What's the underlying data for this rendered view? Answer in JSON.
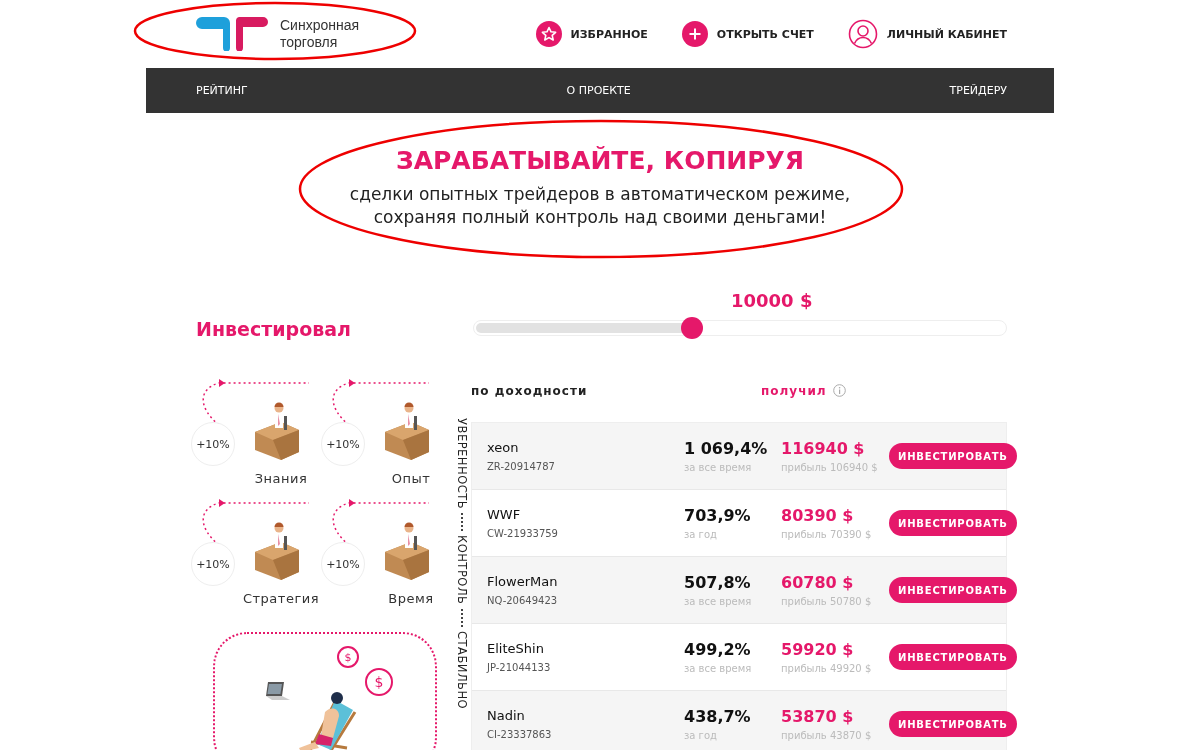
{
  "logo": {
    "lines": [
      "Синхронная",
      "торговля"
    ]
  },
  "header_links": [
    {
      "kind": "star",
      "label": "ИЗБРАННОЕ"
    },
    {
      "kind": "plus",
      "label": "ОТКРЫТЬ СЧЕТ"
    },
    {
      "kind": "user",
      "label": "ЛИЧНЫЙ КАБИНЕТ"
    }
  ],
  "nav": [
    "РЕЙТИНГ",
    "О ПРОЕКТЕ",
    "ТРЕЙДЕРУ"
  ],
  "hero": {
    "title": "ЗАРАБАТЫВАЙТЕ, КОПИРУЯ",
    "subtitle": "сделки опытных трейдеров в автоматическом режиме,\nсохраняя полный контроль над своими деньгами!"
  },
  "investment": {
    "label": "Инвестировал",
    "amount": "10000 $",
    "level": 0.41
  },
  "benefits": [
    {
      "badge": "+10%",
      "label": "Знания"
    },
    {
      "badge": "+10%",
      "label": "Опыт"
    },
    {
      "badge": "+10%",
      "label": "Стратегия"
    },
    {
      "badge": "+10%",
      "label": "Время"
    }
  ],
  "coins": [
    "$",
    "$"
  ],
  "side_caption": [
    "УВЕРЕННОСТЬ",
    "КОНТРОЛЬ",
    "СТАБИЛЬНО"
  ],
  "table": {
    "columns": [
      "по доходности",
      "получил"
    ],
    "rows": [
      {
        "name": "xeon",
        "account": "ZR-20914787",
        "yield": "1 069,4%",
        "period": "за все время",
        "received": "116940 $",
        "profit": "прибыль 106940 $",
        "button": "ИНВЕСТИРОВАТЬ"
      },
      {
        "name": "WWF",
        "account": "CW-21933759",
        "yield": "703,9%",
        "period": "за год",
        "received": "80390 $",
        "profit": "прибыль 70390 $",
        "button": "ИНВЕСТИРОВАТЬ"
      },
      {
        "name": "FlowerMan",
        "account": "NQ-20649423",
        "yield": "507,8%",
        "period": "за все время",
        "received": "60780 $",
        "profit": "прибыль 50780 $",
        "button": "ИНВЕСТИРОВАТЬ"
      },
      {
        "name": "EliteShin",
        "account": "JP-21044133",
        "yield": "499,2%",
        "period": "за все время",
        "received": "59920 $",
        "profit": "прибыль 49920 $",
        "button": "ИНВЕСТИРОВАТЬ"
      },
      {
        "name": "Nadin",
        "account": "CI-23337863",
        "yield": "438,7%",
        "period": "за год",
        "received": "53870 $",
        "profit": "прибыль 43870 $",
        "button": "ИНВЕСТИРОВАТЬ"
      }
    ]
  }
}
